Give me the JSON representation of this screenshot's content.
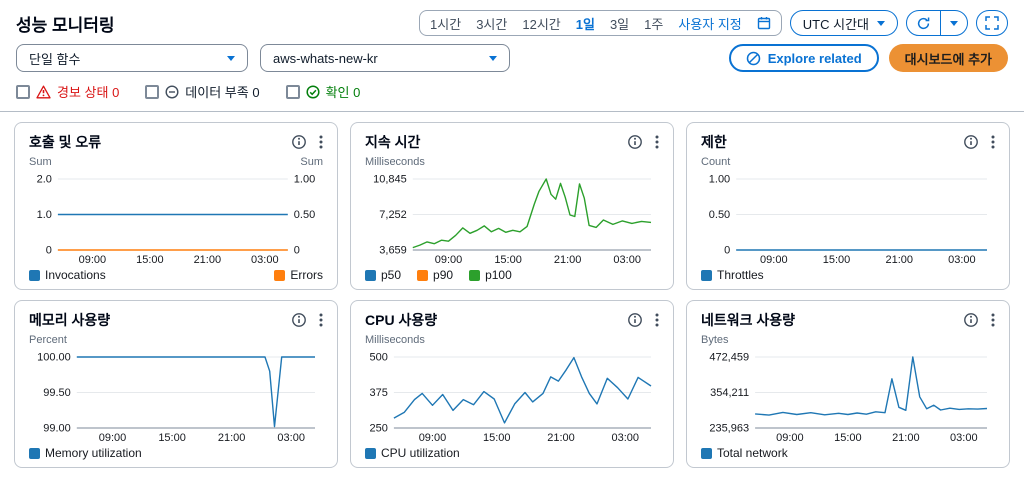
{
  "colors": {
    "series_blue": "#1f77b4",
    "series_orange": "#ff7f0e",
    "series_green": "#2ca02c",
    "link_blue": "#0972d3",
    "alarm_red": "#d91515",
    "ok_green": "#037f0c",
    "button_orange": "#ec9134"
  },
  "header": {
    "title": "성능 모니터링"
  },
  "time_controls": {
    "ranges": [
      "1시간",
      "3시간",
      "12시간",
      "1일",
      "3일",
      "1주"
    ],
    "selected": "1일",
    "custom_label": "사용자 지정",
    "timezone_select": "UTC 시간대"
  },
  "filters": {
    "scope_select": "단일 함수",
    "function_select": "aws-whats-new-kr"
  },
  "actions": {
    "explore": "Explore related",
    "add_to_dashboard": "대시보드에 추가"
  },
  "alarm_filters": [
    {
      "label": "경보 상태 0"
    },
    {
      "label": "데이터 부족 0"
    },
    {
      "label": "확인 0"
    }
  ],
  "chart_data": [
    {
      "type": "line",
      "title": "호출 및 오류",
      "unit_left": "Sum",
      "unit_right": "Sum",
      "y_left": {
        "min": 0,
        "max": 2,
        "ticks": [
          {
            "v": 0,
            "label": "0"
          },
          {
            "v": 1,
            "label": "1.0"
          },
          {
            "v": 2,
            "label": "2.0"
          }
        ]
      },
      "y_right": {
        "min": 0,
        "max": 1,
        "ticks": [
          {
            "v": 0,
            "label": "0"
          },
          {
            "v": 0.5,
            "label": "0.50"
          },
          {
            "v": 1,
            "label": "1.00"
          }
        ]
      },
      "x_ticks": [
        {
          "pos": 15,
          "label": "09:00"
        },
        {
          "pos": 40,
          "label": "15:00"
        },
        {
          "pos": 65,
          "label": "21:00"
        },
        {
          "pos": 90,
          "label": "03:00"
        }
      ],
      "series": [
        {
          "name": "Invocations",
          "color": "#1f77b4",
          "axis": "left",
          "points": [
            [
              0,
              1
            ],
            [
              100,
              1
            ]
          ]
        },
        {
          "name": "Errors",
          "color": "#ff7f0e",
          "axis": "right",
          "points": [
            [
              0,
              0
            ],
            [
              100,
              0
            ]
          ]
        }
      ],
      "legend": [
        {
          "label": "Invocations",
          "color": "#1f77b4"
        },
        {
          "label": "Errors",
          "color": "#ff7f0e",
          "align": "right"
        }
      ]
    },
    {
      "type": "line",
      "title": "지속 시간",
      "unit_left": "Milliseconds",
      "y_left": {
        "min": 3659,
        "max": 10845,
        "ticks": [
          {
            "v": 3659,
            "label": "3,659"
          },
          {
            "v": 7252,
            "label": "7,252"
          },
          {
            "v": 10845,
            "label": "10,845"
          }
        ]
      },
      "x_ticks": [
        {
          "pos": 15,
          "label": "09:00"
        },
        {
          "pos": 40,
          "label": "15:00"
        },
        {
          "pos": 65,
          "label": "21:00"
        },
        {
          "pos": 90,
          "label": "03:00"
        }
      ],
      "series": [
        {
          "name": "p100",
          "color": "#2ca02c",
          "axis": "left",
          "points": [
            [
              0,
              3900
            ],
            [
              3,
              4150
            ],
            [
              6,
              4480
            ],
            [
              9,
              4300
            ],
            [
              12,
              4650
            ],
            [
              15,
              4550
            ],
            [
              18,
              5150
            ],
            [
              21,
              5900
            ],
            [
              24,
              5350
            ],
            [
              27,
              5650
            ],
            [
              30,
              6100
            ],
            [
              33,
              5500
            ],
            [
              36,
              5850
            ],
            [
              39,
              5450
            ],
            [
              42,
              5650
            ],
            [
              45,
              5500
            ],
            [
              48,
              6050
            ],
            [
              51,
              8300
            ],
            [
              53,
              9600
            ],
            [
              56,
              10845
            ],
            [
              58,
              9300
            ],
            [
              60,
              8800
            ],
            [
              62,
              10400
            ],
            [
              64,
              9000
            ],
            [
              66,
              7200
            ],
            [
              68,
              7050
            ],
            [
              70,
              10350
            ],
            [
              72,
              8900
            ],
            [
              74,
              6150
            ],
            [
              77,
              5950
            ],
            [
              80,
              6700
            ],
            [
              84,
              6250
            ],
            [
              88,
              6600
            ],
            [
              92,
              6350
            ],
            [
              96,
              6550
            ],
            [
              100,
              6450
            ]
          ]
        }
      ],
      "legend": [
        {
          "label": "p50",
          "color": "#1f77b4"
        },
        {
          "label": "p90",
          "color": "#ff7f0e"
        },
        {
          "label": "p100",
          "color": "#2ca02c"
        }
      ]
    },
    {
      "type": "line",
      "title": "제한",
      "unit_left": "Count",
      "y_left": {
        "min": 0,
        "max": 1,
        "ticks": [
          {
            "v": 0,
            "label": "0"
          },
          {
            "v": 0.5,
            "label": "0.50"
          },
          {
            "v": 1,
            "label": "1.00"
          }
        ]
      },
      "x_ticks": [
        {
          "pos": 15,
          "label": "09:00"
        },
        {
          "pos": 40,
          "label": "15:00"
        },
        {
          "pos": 65,
          "label": "21:00"
        },
        {
          "pos": 90,
          "label": "03:00"
        }
      ],
      "series": [
        {
          "name": "Throttles",
          "color": "#1f77b4",
          "axis": "left",
          "points": [
            [
              0,
              0
            ],
            [
              100,
              0
            ]
          ]
        }
      ],
      "legend": [
        {
          "label": "Throttles",
          "color": "#1f77b4"
        }
      ]
    },
    {
      "type": "line",
      "title": "메모리 사용량",
      "unit_left": "Percent",
      "y_left": {
        "min": 99,
        "max": 100,
        "ticks": [
          {
            "v": 99,
            "label": "99.00"
          },
          {
            "v": 99.5,
            "label": "99.50"
          },
          {
            "v": 100,
            "label": "100.00"
          }
        ]
      },
      "x_ticks": [
        {
          "pos": 15,
          "label": "09:00"
        },
        {
          "pos": 40,
          "label": "15:00"
        },
        {
          "pos": 65,
          "label": "21:00"
        },
        {
          "pos": 90,
          "label": "03:00"
        }
      ],
      "series": [
        {
          "name": "Memory utilization",
          "color": "#1f77b4",
          "axis": "left",
          "points": [
            [
              0,
              100
            ],
            [
              79,
              100
            ],
            [
              81,
              99.8
            ],
            [
              83,
              99.02
            ],
            [
              86,
              100
            ],
            [
              100,
              100
            ]
          ]
        }
      ],
      "legend": [
        {
          "label": "Memory utilization",
          "color": "#1f77b4"
        }
      ]
    },
    {
      "type": "line",
      "title": "CPU 사용량",
      "unit_left": "Milliseconds",
      "y_left": {
        "min": 250,
        "max": 500,
        "ticks": [
          {
            "v": 250,
            "label": "250"
          },
          {
            "v": 375,
            "label": "375"
          },
          {
            "v": 500,
            "label": "500"
          }
        ]
      },
      "x_ticks": [
        {
          "pos": 15,
          "label": "09:00"
        },
        {
          "pos": 40,
          "label": "15:00"
        },
        {
          "pos": 65,
          "label": "21:00"
        },
        {
          "pos": 90,
          "label": "03:00"
        }
      ],
      "series": [
        {
          "name": "CPU utilization",
          "color": "#1f77b4",
          "axis": "left",
          "points": [
            [
              0,
              285
            ],
            [
              4,
              305
            ],
            [
              8,
              350
            ],
            [
              11,
              372
            ],
            [
              15,
              330
            ],
            [
              19,
              368
            ],
            [
              23,
              312
            ],
            [
              27,
              350
            ],
            [
              31,
              332
            ],
            [
              35,
              378
            ],
            [
              39,
              352
            ],
            [
              43,
              268
            ],
            [
              47,
              335
            ],
            [
              51,
              375
            ],
            [
              54,
              342
            ],
            [
              58,
              372
            ],
            [
              61,
              430
            ],
            [
              64,
              415
            ],
            [
              67,
              455
            ],
            [
              70,
              498
            ],
            [
              73,
              430
            ],
            [
              76,
              372
            ],
            [
              79,
              335
            ],
            [
              83,
              425
            ],
            [
              87,
              392
            ],
            [
              91,
              352
            ],
            [
              95,
              428
            ],
            [
              100,
              398
            ]
          ]
        }
      ],
      "legend": [
        {
          "label": "CPU utilization",
          "color": "#1f77b4"
        }
      ]
    },
    {
      "type": "line",
      "title": "네트워크 사용량",
      "unit_left": "Bytes",
      "y_left": {
        "min": 235963,
        "max": 472459,
        "ticks": [
          {
            "v": 235963,
            "label": "235,963"
          },
          {
            "v": 354211,
            "label": "354,211"
          },
          {
            "v": 472459,
            "label": "472,459"
          }
        ]
      },
      "x_ticks": [
        {
          "pos": 15,
          "label": "09:00"
        },
        {
          "pos": 40,
          "label": "15:00"
        },
        {
          "pos": 65,
          "label": "21:00"
        },
        {
          "pos": 90,
          "label": "03:00"
        }
      ],
      "series": [
        {
          "name": "Total network",
          "color": "#1f77b4",
          "axis": "left",
          "points": [
            [
              0,
              283000
            ],
            [
              6,
              279000
            ],
            [
              12,
              288000
            ],
            [
              18,
              281000
            ],
            [
              24,
              287000
            ],
            [
              30,
              280000
            ],
            [
              36,
              285000
            ],
            [
              40,
              281000
            ],
            [
              44,
              286000
            ],
            [
              48,
              282000
            ],
            [
              52,
              290000
            ],
            [
              56,
              287000
            ],
            [
              59,
              400000
            ],
            [
              62,
              305000
            ],
            [
              65,
              295000
            ],
            [
              68,
              472459
            ],
            [
              71,
              340000
            ],
            [
              74,
              300000
            ],
            [
              77,
              312000
            ],
            [
              80,
              296000
            ],
            [
              84,
              302000
            ],
            [
              88,
              298000
            ],
            [
              92,
              300000
            ],
            [
              96,
              299000
            ],
            [
              100,
              301000
            ]
          ]
        }
      ],
      "legend": [
        {
          "label": "Total network",
          "color": "#1f77b4"
        }
      ]
    }
  ]
}
